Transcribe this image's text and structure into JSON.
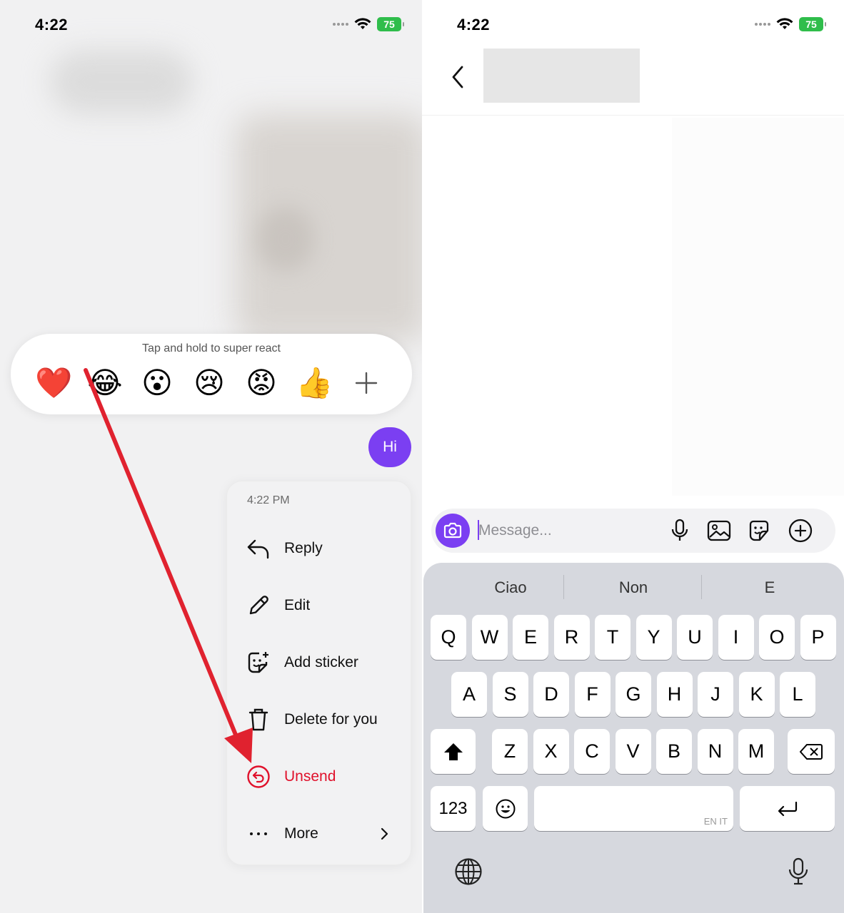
{
  "left": {
    "status": {
      "time": "4:22",
      "battery": "75"
    },
    "reactions": {
      "hint": "Tap and hold to super react",
      "emojis": [
        {
          "name": "heart",
          "glyph": "❤️"
        },
        {
          "name": "laugh",
          "glyph": "😂"
        },
        {
          "name": "wow",
          "glyph": "😮"
        },
        {
          "name": "cry",
          "glyph": "😢"
        },
        {
          "name": "angry",
          "glyph": "😡"
        },
        {
          "name": "thumbs-up",
          "glyph": "👍"
        }
      ],
      "more_icon": "plus-icon"
    },
    "message": {
      "text": "Hi",
      "bubble_color": "#7b3ff2"
    },
    "menu": {
      "time": "4:22 PM",
      "items": [
        {
          "label": "Reply",
          "icon": "reply-icon"
        },
        {
          "label": "Edit",
          "icon": "pencil-icon"
        },
        {
          "label": "Add sticker",
          "icon": "sticker-icon"
        },
        {
          "label": "Delete for you",
          "icon": "trash-icon"
        },
        {
          "label": "Unsend",
          "icon": "unsend-icon",
          "color": "#e0112b"
        },
        {
          "label": "More",
          "icon": "more-dots-icon"
        }
      ]
    },
    "annotation_color": "#e0222f"
  },
  "right": {
    "status": {
      "time": "4:22",
      "battery": "75"
    },
    "composer": {
      "placeholder": "Message..."
    },
    "keyboard": {
      "suggestions": [
        "Ciao",
        "Non",
        "E"
      ],
      "row1": [
        "Q",
        "W",
        "E",
        "R",
        "T",
        "Y",
        "U",
        "I",
        "O",
        "P"
      ],
      "row2": [
        "A",
        "S",
        "D",
        "F",
        "G",
        "H",
        "J",
        "K",
        "L"
      ],
      "row3": [
        "Z",
        "X",
        "C",
        "V",
        "B",
        "N",
        "M"
      ],
      "numbers_label": "123",
      "space_lang": "EN IT"
    },
    "accent": "#7b3ff2"
  }
}
